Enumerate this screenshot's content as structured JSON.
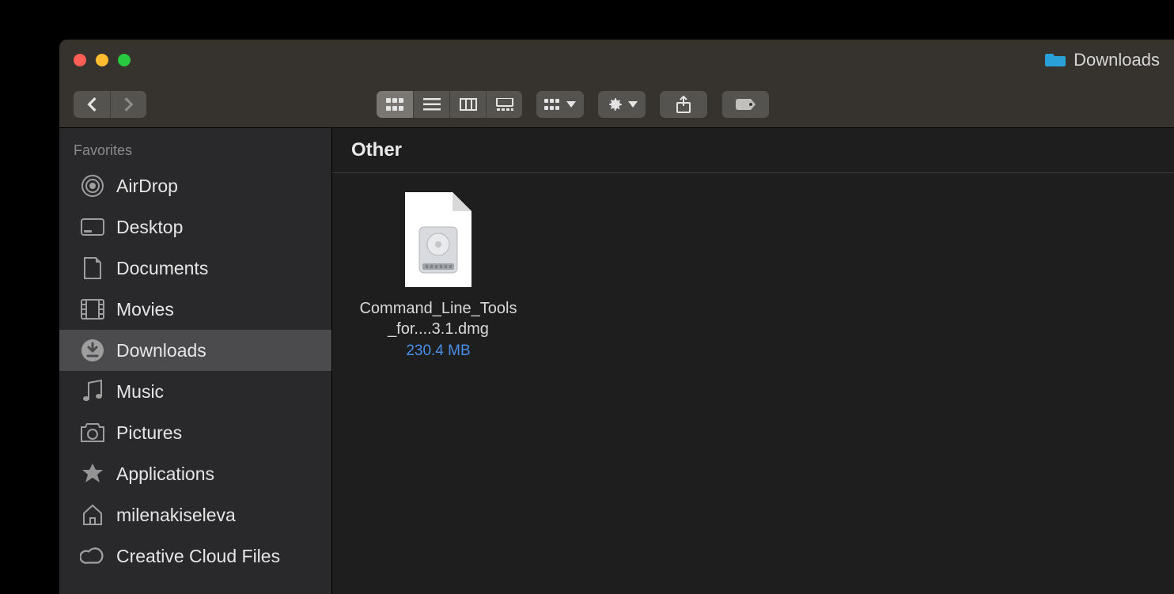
{
  "window": {
    "title": "Downloads"
  },
  "sidebar": {
    "section": "Favorites",
    "items": [
      {
        "label": "AirDrop"
      },
      {
        "label": "Desktop"
      },
      {
        "label": "Documents"
      },
      {
        "label": "Movies"
      },
      {
        "label": "Downloads"
      },
      {
        "label": "Music"
      },
      {
        "label": "Pictures"
      },
      {
        "label": "Applications"
      },
      {
        "label": "milenakiseleva"
      },
      {
        "label": "Creative Cloud Files"
      }
    ]
  },
  "content": {
    "group_header": "Other",
    "files": [
      {
        "name": "Command_Line_Tools_for....3.1.dmg",
        "size": "230.4 MB"
      }
    ]
  }
}
